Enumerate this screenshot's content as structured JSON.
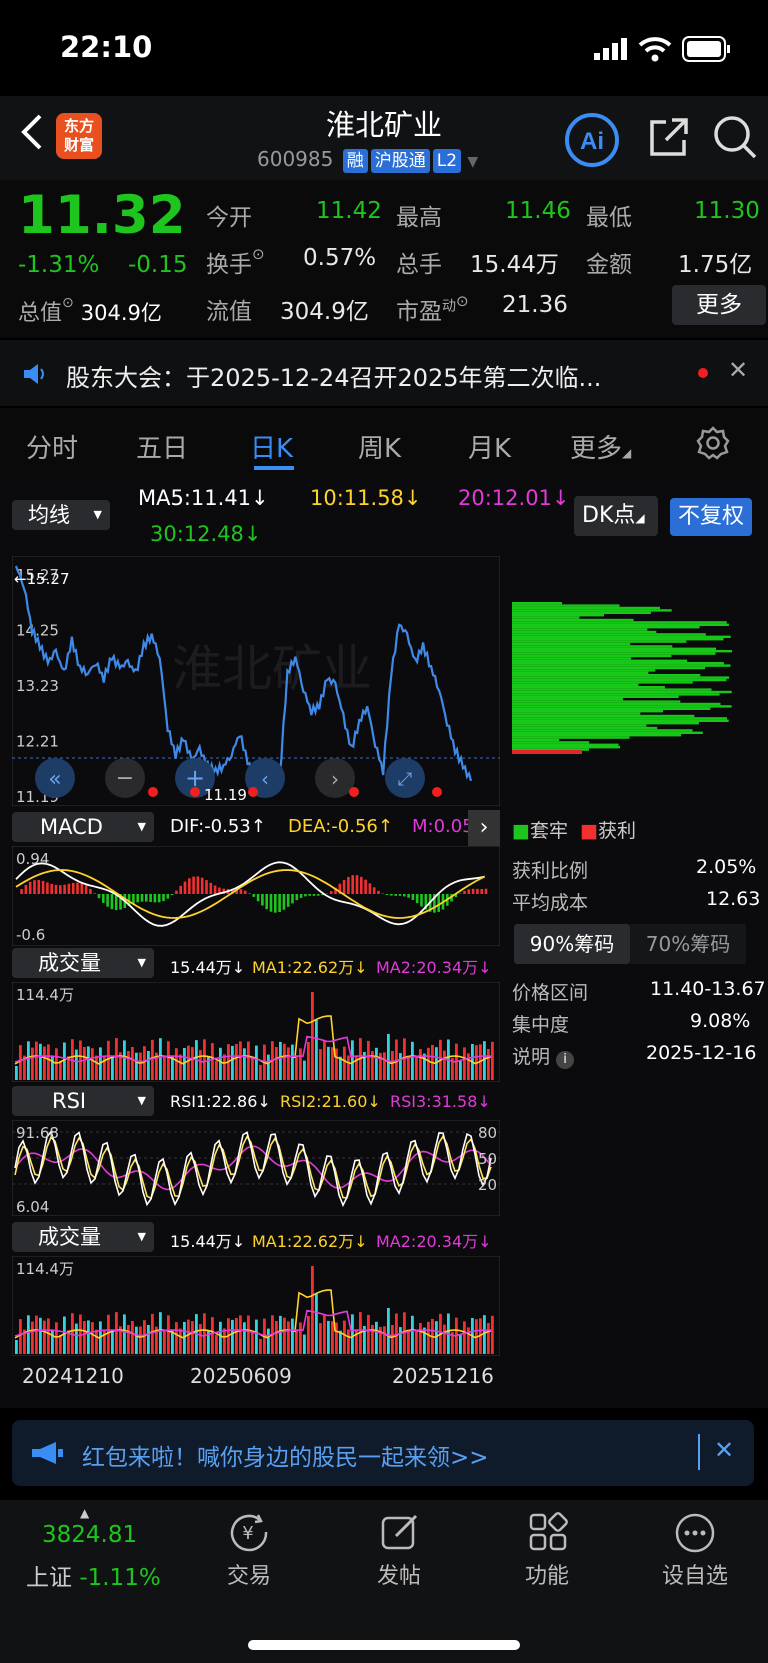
{
  "status": {
    "time": "22:10"
  },
  "header": {
    "logo": "东方\n财富",
    "title": "淮北矿业",
    "code": "600985",
    "tags": [
      "融",
      "沪股通",
      "L2"
    ]
  },
  "quote": {
    "price": "11.32",
    "pct": "-1.31%",
    "chg": "-0.15",
    "open_k": "今开",
    "open": "11.42",
    "high_k": "最高",
    "high": "11.46",
    "low_k": "最低",
    "low": "11.30",
    "turn_k": "换手",
    "turn": "0.57%",
    "vol_k": "总手",
    "vol": "15.44万",
    "amt_k": "金额",
    "amt": "1.75亿",
    "cap_k": "总值",
    "cap": "304.9亿",
    "flt_k": "流值",
    "flt": "304.9亿",
    "pe_k": "市盈",
    "pe_sup": "动",
    "pe": "21.36",
    "more": "更多"
  },
  "notice": {
    "text": "股东大会：于2025-12-24召开2025年第二次临..."
  },
  "tabs": [
    "分时",
    "五日",
    "日K",
    "周K",
    "月K",
    "更多"
  ],
  "ma": {
    "selector": "均线",
    "ma5": "MA5:11.41↓",
    "ma10": "10:11.58↓",
    "ma20": "20:12.01↓",
    "ma30": "30:12.48↓",
    "dk": "DK点",
    "fq": "不复权"
  },
  "kline": {
    "y_ticks": [
      "15.27",
      "14.25",
      "13.23",
      "12.21",
      "11.19"
    ],
    "max_label": "←15.27",
    "min_label": "11.19"
  },
  "macd": {
    "name": "MACD",
    "dif": "DIF:-0.53↑",
    "dea": "DEA:-0.56↑",
    "m": "M:0.05",
    "top": "0.94",
    "bottom": "-0.6"
  },
  "vol1": {
    "name": "成交量",
    "v": "15.44万↓",
    "ma1": "MA1:22.62万↓",
    "ma2": "MA2:20.34万↓",
    "top": "114.4万"
  },
  "rsi": {
    "name": "RSI",
    "r1": "RSI1:22.86↓",
    "r2": "RSI2:21.60↓",
    "r3": "RSI3:31.58↓",
    "top": "91.68",
    "bottom": "6.04",
    "l80": "80",
    "l50": "50",
    "l20": "20"
  },
  "vol2": {
    "name": "成交量",
    "v": "15.44万↓",
    "ma1": "MA1:22.62万↓",
    "ma2": "MA2:20.34万↓",
    "top": "114.4万"
  },
  "dates": [
    "20241210",
    "20250609",
    "20251216"
  ],
  "chip": {
    "legend_trap": "套牢",
    "legend_profit": "获利",
    "ratio_k": "获利比例",
    "ratio": "2.05%",
    "cost_k": "平均成本",
    "cost": "12.63",
    "tab90": "90%筹码",
    "tab70": "70%筹码",
    "range_k": "价格区间",
    "range": "11.40-13.67",
    "conc_k": "集中度",
    "conc": "9.08%",
    "note_k": "说明",
    "note": "2025-12-16"
  },
  "banner": {
    "text": "红包来啦！喊你身边的股民一起来领>>"
  },
  "bottom": {
    "index_val": "3824.81",
    "index_name": "上证",
    "index_pct": "-1.11%",
    "items": [
      "交易",
      "发帖",
      "功能",
      "设自选"
    ]
  },
  "chart_data": {
    "type": "line",
    "title": "",
    "ylim": [
      11.19,
      15.27
    ],
    "series": [
      {
        "values": [
          15.27,
          14.9,
          14.1,
          13.8,
          13.5,
          13.7,
          13.3,
          13.9,
          13.4,
          13.3,
          13.5,
          13.2,
          13.6,
          13.4,
          13.5,
          13.3,
          13.8,
          14.0,
          13.6,
          12.3,
          11.8,
          12.1,
          11.7,
          11.9,
          11.6,
          11.5,
          11.6,
          11.8,
          12.2,
          11.7,
          11.2,
          11.3,
          11.25,
          11.3,
          13.3,
          13.6,
          13.0,
          12.6,
          12.7,
          13.2,
          13.1,
          12.5,
          11.9,
          12.4,
          12.7,
          12.0,
          11.5,
          13.3,
          14.2,
          14.0,
          13.5,
          13.8,
          13.4,
          13.0,
          12.4,
          11.9,
          11.6,
          11.32
        ]
      }
    ]
  }
}
